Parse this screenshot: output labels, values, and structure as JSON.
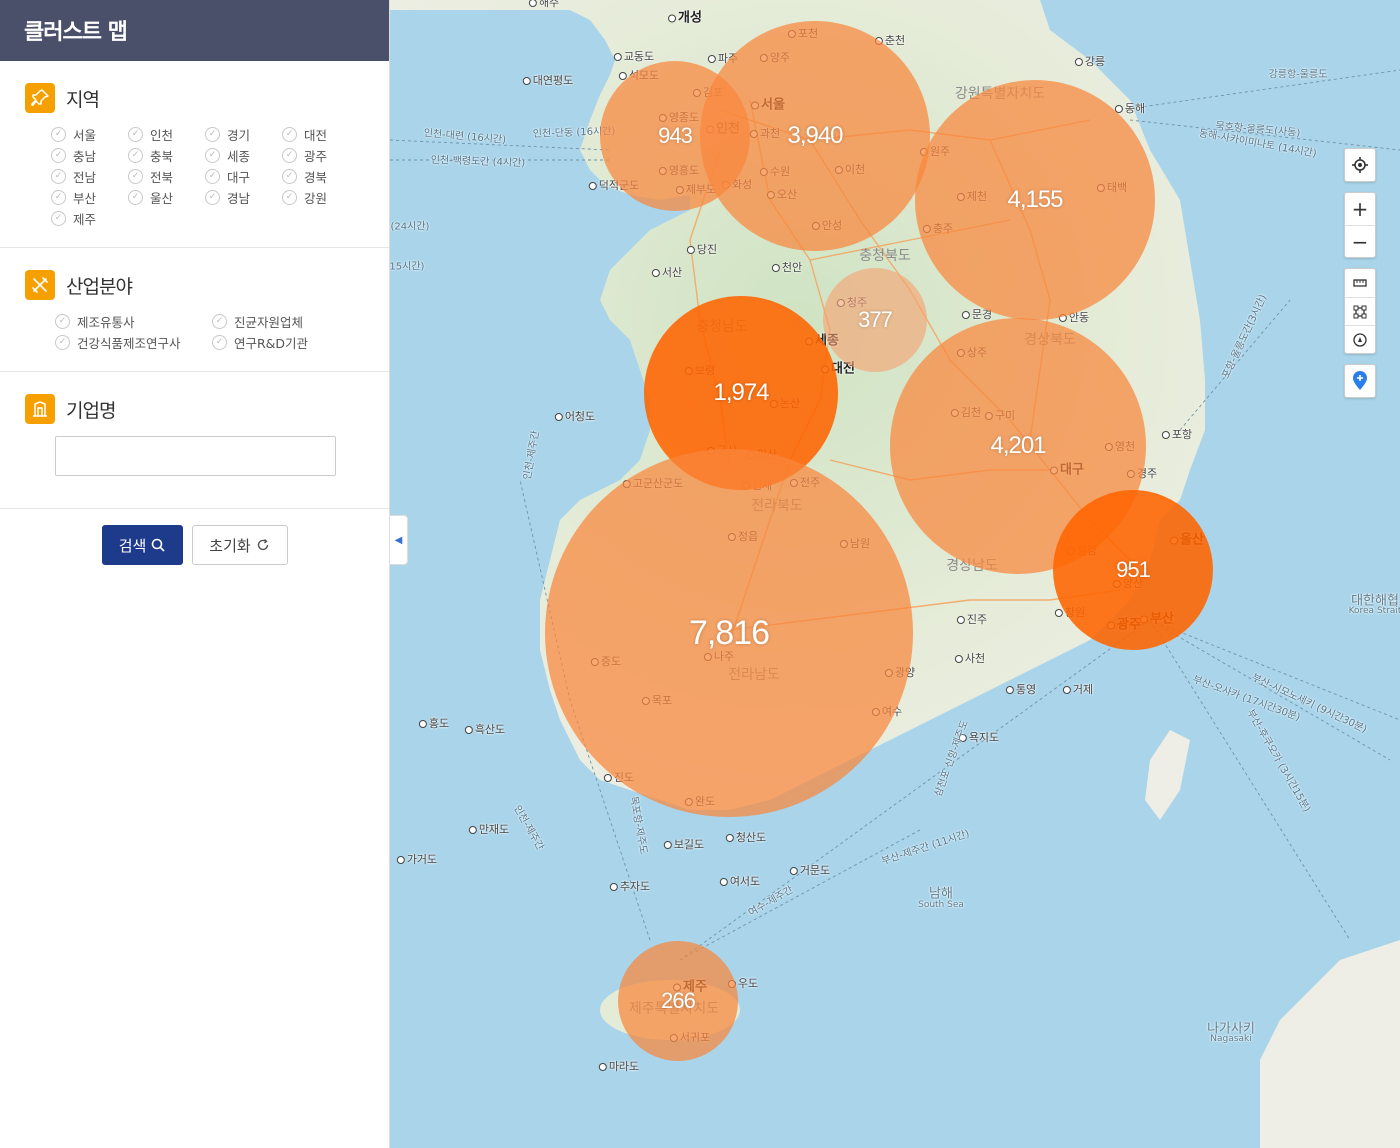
{
  "app": {
    "title": "클러스트 맵"
  },
  "region": {
    "title": "지역",
    "items": [
      "서울",
      "인천",
      "경기",
      "대전",
      "충남",
      "충북",
      "세종",
      "광주",
      "전남",
      "전북",
      "대구",
      "경북",
      "부산",
      "울산",
      "경남",
      "강원",
      "제주"
    ]
  },
  "industry": {
    "title": "산업분야",
    "items": [
      "제조유통사",
      "진균자원업체",
      "건강식품제조연구사",
      "연구R&D기관"
    ]
  },
  "company": {
    "title": "기업명",
    "placeholder": "",
    "value": ""
  },
  "buttons": {
    "search": "검색",
    "reset": "초기화"
  },
  "colors": {
    "header_bg": "#4a5069",
    "accent": "#f5a000",
    "search_btn": "#1e3a8a",
    "cluster_light": "#f7904a",
    "cluster_dark": "#ff6a00"
  },
  "map": {
    "clusters": [
      {
        "id": "incheon",
        "count": "943",
        "shade": "light"
      },
      {
        "id": "seoul",
        "count": "3,940",
        "shade": "light"
      },
      {
        "id": "gangwon",
        "count": "4,155",
        "shade": "light"
      },
      {
        "id": "chungbuk",
        "count": "377",
        "shade": "pale"
      },
      {
        "id": "chungnam",
        "count": "1,974",
        "shade": "dark"
      },
      {
        "id": "gyeongbuk",
        "count": "4,201",
        "shade": "light"
      },
      {
        "id": "jeonnam",
        "count": "7,816",
        "shade": "light"
      },
      {
        "id": "busan",
        "count": "951",
        "shade": "dark"
      },
      {
        "id": "jeju",
        "count": "266",
        "shade": "light"
      }
    ],
    "labels": {
      "cities": [
        "개성",
        "파주",
        "포천",
        "춘천",
        "양주",
        "강릉",
        "교동도",
        "석모도",
        "김포",
        "서울",
        "인천",
        "과천",
        "영종도",
        "영흥도",
        "수원",
        "화성",
        "오산",
        "이천",
        "원주",
        "제부도",
        "안성",
        "동해",
        "제천",
        "태백",
        "충주",
        "당진",
        "천안",
        "서산",
        "청주",
        "문경",
        "안동",
        "세종",
        "대전",
        "보령",
        "논산",
        "상주",
        "김천",
        "구미",
        "포항",
        "군산",
        "익산",
        "영천",
        "경주",
        "대구",
        "김제",
        "전주",
        "정읍",
        "남원",
        "울산",
        "밀양",
        "양산",
        "부산",
        "광주",
        "창원",
        "진주",
        "나주",
        "광양",
        "사천",
        "목포",
        "여수",
        "통영",
        "거제",
        "흑산도",
        "홍도",
        "진도",
        "완도",
        "욕지도",
        "보길도",
        "청산도",
        "만재도",
        "가거도",
        "추자도",
        "여서도",
        "거문도",
        "제주",
        "우도",
        "서귀포",
        "마라도",
        "어청도",
        "덕적군도",
        "고군산군도",
        "증도",
        "대연평도",
        "해주"
      ],
      "provinces": [
        "강원특별자치도",
        "충청북도",
        "충청남도",
        "경상북도",
        "전라북도",
        "경상남도",
        "전라남도",
        "제주특별자치도"
      ],
      "seas": [
        "남해",
        "South Sea",
        "대한해협",
        "Korea Strait",
        "나가사키",
        "Nagasaki"
      ],
      "routes": [
        "인천-대련 (16시간)",
        "인천-단동 (16시간)",
        "인천-백령도간 (4시간)",
        "강릉항-울릉도",
        "묵호항-울릉도(사동)",
        "동해-사카이미나토 (14시간)",
        "포항-울릉도간(3시간)",
        "부산-오사카 (17시간30분)",
        "부산-시모노세키 (9시간30분)",
        "부산-후쿠오카 (3시간15분)",
        "부산-제주간 (11시간)",
        "여수-제주간",
        "인천-제주간",
        "삼천포 신항-제주도",
        "목포항-제주도",
        "인천-제주간",
        "(24시간)",
        "(15시간)"
      ]
    },
    "controls": [
      "location-button",
      "zoom-in",
      "zoom-out",
      "ruler",
      "area",
      "compass",
      "marker"
    ]
  }
}
